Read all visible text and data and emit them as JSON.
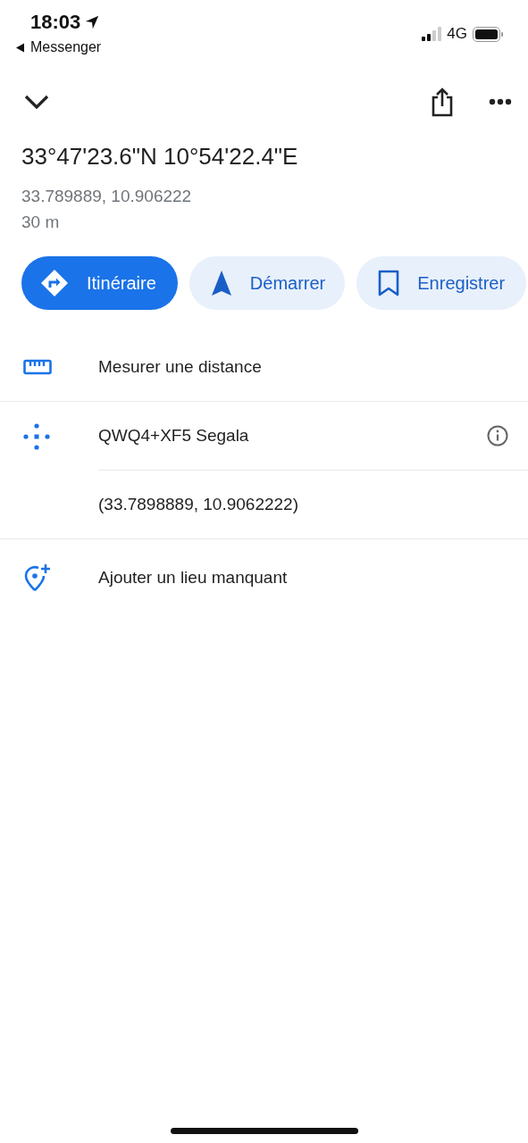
{
  "status_bar": {
    "time": "18:03",
    "back_app": "Messenger",
    "network": "4G"
  },
  "place": {
    "title": "33°47'23.6\"N 10°54'22.4\"E",
    "decimal": "33.789889, 10.906222",
    "accuracy": "30 m"
  },
  "actions": [
    {
      "kind": "directions",
      "label": "Itinéraire"
    },
    {
      "kind": "start",
      "label": "Démarrer"
    },
    {
      "kind": "save",
      "label": "Enregistrer"
    }
  ],
  "rows": [
    {
      "kind": "measure",
      "label": "Mesurer une distance"
    },
    {
      "kind": "pluscode",
      "label": "QWQ4+XF5 Segala"
    },
    {
      "kind": "coords",
      "label": "(33.7898889, 10.9062222)"
    },
    {
      "kind": "add-place",
      "label": "Ajouter un lieu manquant"
    }
  ]
}
